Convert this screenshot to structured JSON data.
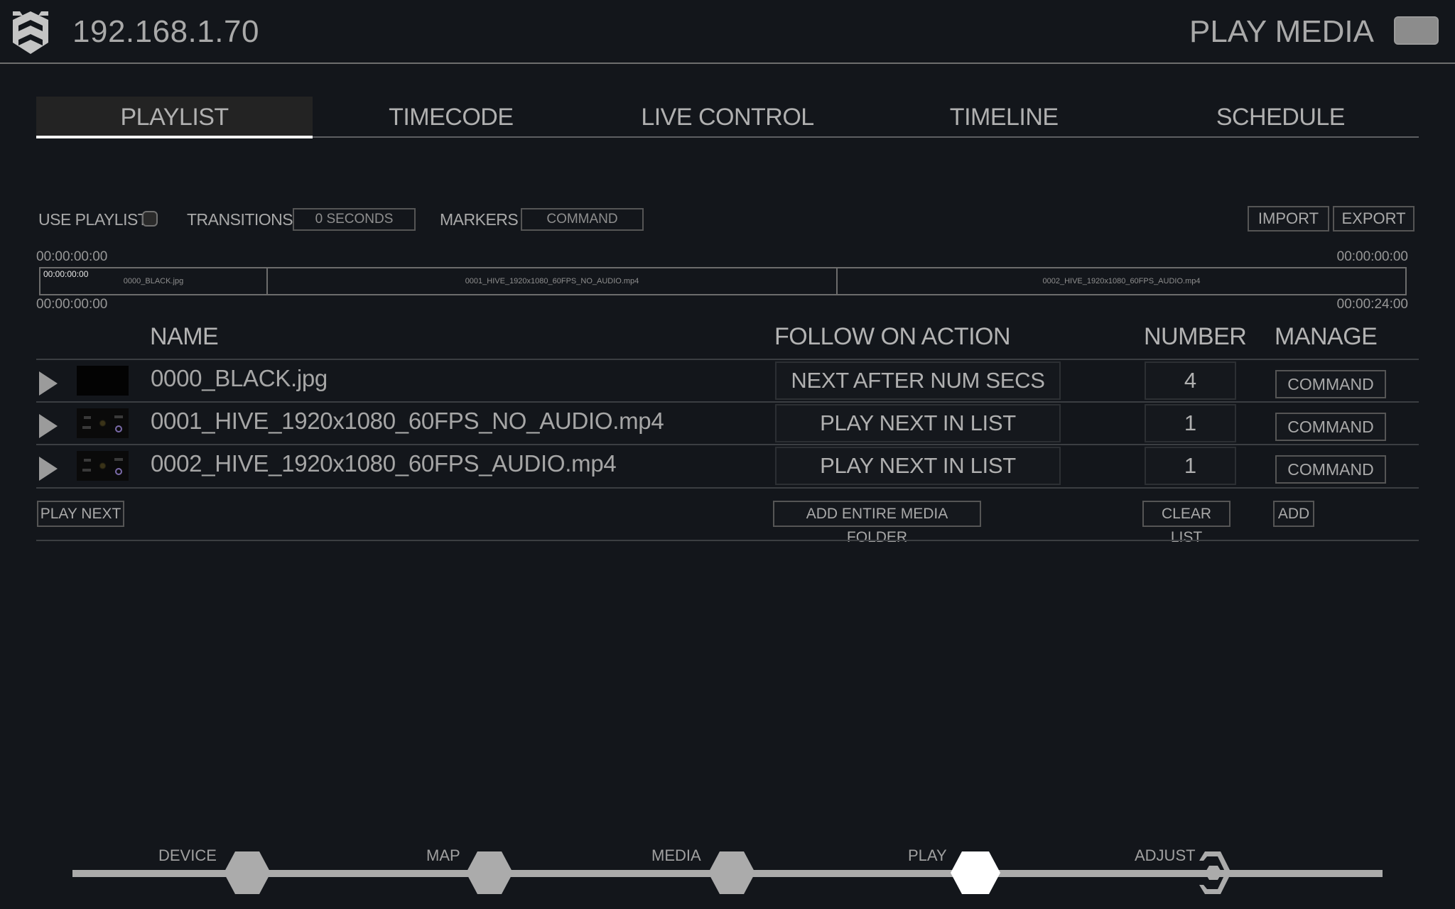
{
  "header": {
    "ip_address": "192.168.1.70",
    "page_label": "PLAY MEDIA",
    "logo_icon": "hive-logo-icon",
    "toggle_icon": "menu-toggle-icon"
  },
  "tabs": [
    {
      "label": "PLAYLIST",
      "active": true
    },
    {
      "label": "TIMECODE",
      "active": false
    },
    {
      "label": "LIVE CONTROL",
      "active": false
    },
    {
      "label": "TIMELINE",
      "active": false
    },
    {
      "label": "SCHEDULE",
      "active": false
    }
  ],
  "options": {
    "use_playlist_label": "USE PLAYLIST",
    "use_playlist_checked": false,
    "transitions_label": "TRANSITIONS",
    "transitions_value": "0 SECONDS",
    "markers_label": "MARKERS",
    "markers_value": "COMMAND",
    "import_label": "IMPORT",
    "export_label": "EXPORT"
  },
  "timeline": {
    "top_left": "00:00:00:00",
    "top_right": "00:00:00:00",
    "bottom_left": "00:00:00:00",
    "bottom_right": "00:00:24:00",
    "playhead_tc": "00:00:00:00",
    "segments": [
      {
        "label": "0000_BLACK.jpg",
        "duration_s": 4
      },
      {
        "label": "0001_HIVE_1920x1080_60FPS_NO_AUDIO.mp4",
        "duration_s": 10
      },
      {
        "label": "0002_HIVE_1920x1080_60FPS_AUDIO.mp4",
        "duration_s": 10
      }
    ]
  },
  "table": {
    "headers": {
      "name": "NAME",
      "follow_on_action": "FOLLOW ON ACTION",
      "number": "NUMBER",
      "manage": "MANAGE"
    },
    "rows": [
      {
        "name": "0000_BLACK.jpg",
        "thumbnail": "black",
        "follow_on_action": "NEXT AFTER NUM SECS",
        "number": "4",
        "manage": "COMMAND"
      },
      {
        "name": "0001_HIVE_1920x1080_60FPS_NO_AUDIO.mp4",
        "thumbnail": "hive",
        "follow_on_action": "PLAY NEXT IN LIST",
        "number": "1",
        "manage": "COMMAND"
      },
      {
        "name": "0002_HIVE_1920x1080_60FPS_AUDIO.mp4",
        "thumbnail": "hive",
        "follow_on_action": "PLAY NEXT IN LIST",
        "number": "1",
        "manage": "COMMAND"
      }
    ]
  },
  "actions": {
    "play_next": "PLAY NEXT",
    "add_entire_media_folder": "ADD ENTIRE MEDIA FOLDER",
    "clear_list": "CLEAR LIST",
    "add": "ADD"
  },
  "bottom_nav": {
    "items": [
      {
        "label": "DEVICE",
        "state": "inactive"
      },
      {
        "label": "MAP",
        "state": "inactive"
      },
      {
        "label": "MEDIA",
        "state": "inactive"
      },
      {
        "label": "PLAY",
        "state": "active"
      },
      {
        "label": "ADJUST",
        "state": "adjust"
      }
    ]
  },
  "colors": {
    "background": "#13161b",
    "text": "#a9a9a9",
    "active_tab_bg": "#232323",
    "active_indicator": "#f2f2f2",
    "nav_inactive": "#ababab",
    "nav_active": "#ffffff"
  }
}
